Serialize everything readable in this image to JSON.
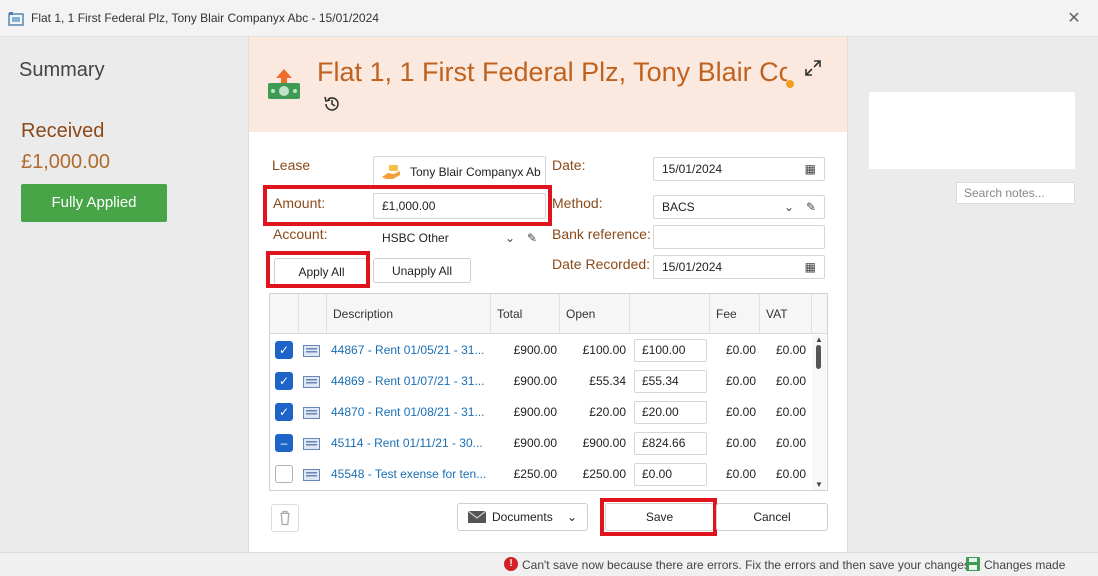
{
  "window": {
    "title": "Flat 1, 1 First Federal Plz, Tony Blair Companyx Abc - 15/01/2024"
  },
  "summary": {
    "title": "Summary",
    "received_label": "Received",
    "received_amount": "£1,000.00",
    "status_button": "Fully Applied"
  },
  "header": {
    "title": "Flat 1, 1 First Federal Plz, Tony Blair Cc"
  },
  "form": {
    "lease_label": "Lease",
    "lease_value": "Tony Blair Companyx Ab",
    "amount_label": "Amount:",
    "amount_value": "£1,000.00",
    "account_label": "Account:",
    "account_value": "HSBC Other",
    "date_label": "Date:",
    "date_value": "15/01/2024",
    "method_label": "Method:",
    "method_value": "BACS",
    "bank_ref_label": "Bank reference:",
    "bank_ref_value": "",
    "date_recorded_label": "Date Recorded:",
    "date_recorded_value": "15/01/2024"
  },
  "buttons": {
    "apply_all": "Apply All",
    "unapply_all": "Unapply All",
    "documents": "Documents",
    "save": "Save",
    "cancel": "Cancel"
  },
  "grid": {
    "columns": [
      "Description",
      "Total",
      "Open",
      "",
      "Fee",
      "VAT"
    ],
    "rows": [
      {
        "checked": "checked",
        "description": "44867 - Rent 01/05/21 - 31...",
        "total": "£900.00",
        "open": "£100.00",
        "apply": "£100.00",
        "fee": "£0.00",
        "vat": "£0.00"
      },
      {
        "checked": "checked",
        "description": "44869 - Rent 01/07/21 - 31...",
        "total": "£900.00",
        "open": "£55.34",
        "apply": "£55.34",
        "fee": "£0.00",
        "vat": "£0.00"
      },
      {
        "checked": "checked",
        "description": "44870 - Rent 01/08/21 - 31...",
        "total": "£900.00",
        "open": "£20.00",
        "apply": "£20.00",
        "fee": "£0.00",
        "vat": "£0.00"
      },
      {
        "checked": "partial",
        "description": "45114 - Rent 01/11/21 - 30...",
        "total": "£900.00",
        "open": "£900.00",
        "apply": "£824.66",
        "fee": "£0.00",
        "vat": "£0.00"
      },
      {
        "checked": "unchecked",
        "description": "45548 - Test exense for ten...",
        "total": "£250.00",
        "open": "£250.00",
        "apply": "£0.00",
        "fee": "£0.00",
        "vat": "£0.00"
      }
    ]
  },
  "notes": {
    "search_placeholder": "Search notes..."
  },
  "status": {
    "error_text": "Can't save now because there are errors. Fix the errors and then save your changes",
    "changes_text": "Changes made"
  },
  "colors": {
    "accent": "#c0621f",
    "applied": "#47a447",
    "error": "#e0141e",
    "link": "#1a6fb5",
    "checkbox": "#1e64c8"
  }
}
